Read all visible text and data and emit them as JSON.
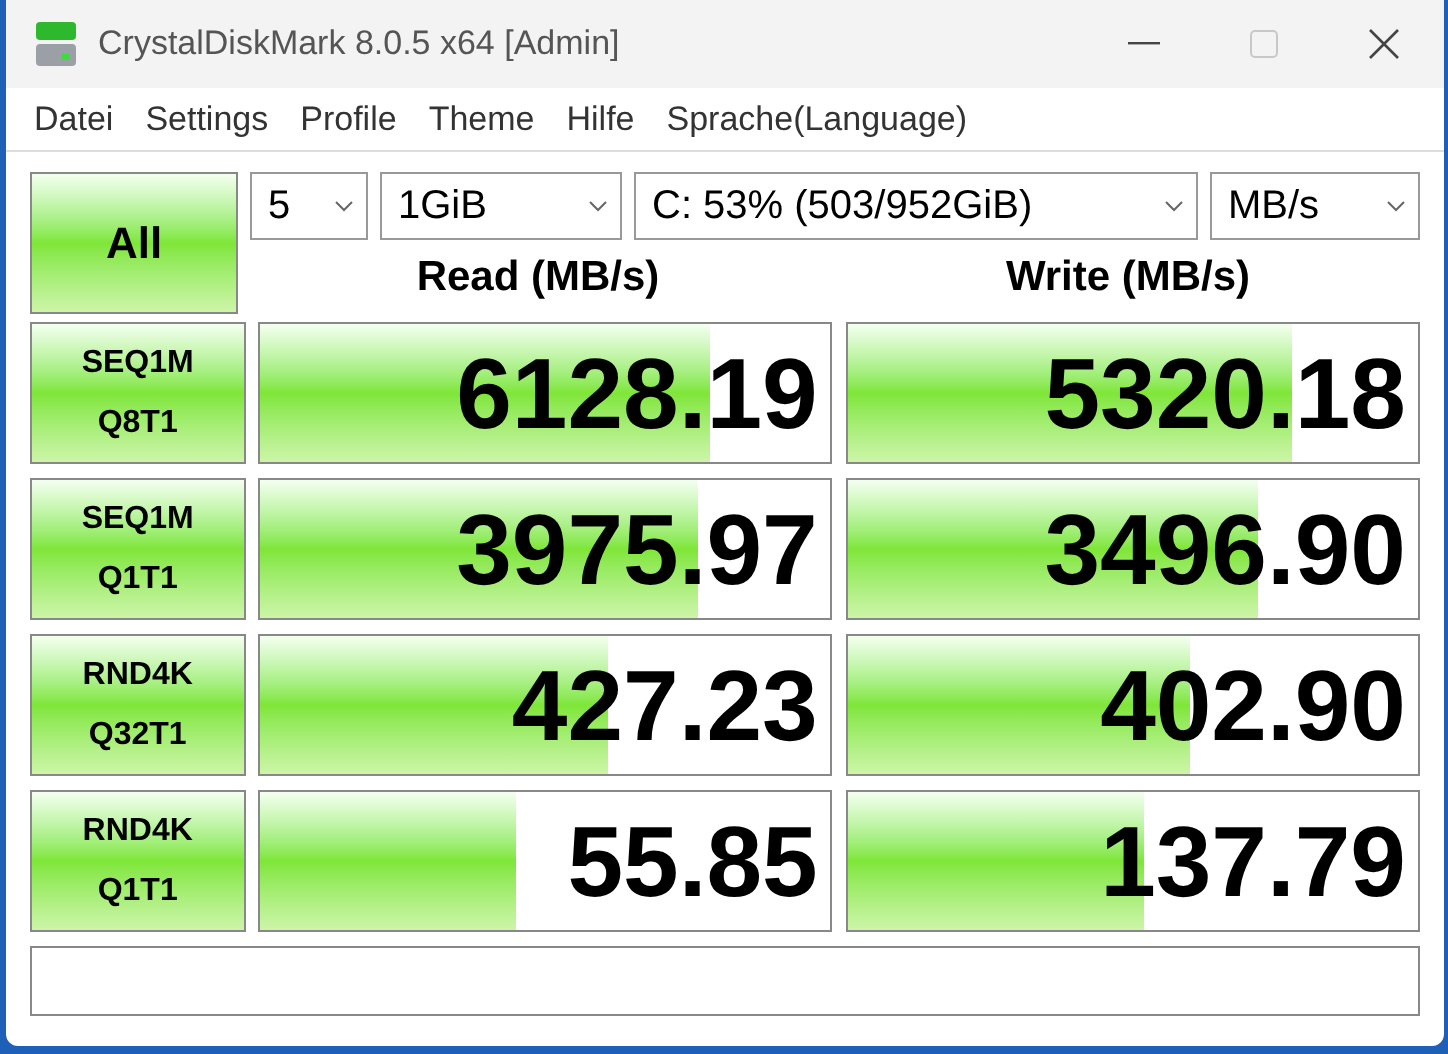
{
  "window": {
    "title": "CrystalDiskMark 8.0.5 x64 [Admin]",
    "maximize_disabled": true
  },
  "menu": [
    "Datei",
    "Settings",
    "Profile",
    "Theme",
    "Hilfe",
    "Sprache(Language)"
  ],
  "all_button": "All",
  "selectors": [
    {
      "kind": "count",
      "value": "5"
    },
    {
      "kind": "size",
      "value": "1GiB"
    },
    {
      "kind": "drive",
      "value": "C: 53% (503/952GiB)"
    },
    {
      "kind": "unit",
      "value": "MB/s"
    }
  ],
  "headers": {
    "read": "Read (MB/s)",
    "write": "Write (MB/s)"
  },
  "rows": [
    {
      "lines": [
        "SEQ1M",
        "Q8T1"
      ],
      "read": {
        "value": "6128.19",
        "level": 0.79
      },
      "write": {
        "value": "5320.18",
        "level": 0.78
      }
    },
    {
      "lines": [
        "SEQ1M",
        "Q1T1"
      ],
      "read": {
        "value": "3975.97",
        "level": 0.77
      },
      "write": {
        "value": "3496.90",
        "level": 0.72
      }
    },
    {
      "lines": [
        "RND4K",
        "Q32T1"
      ],
      "read": {
        "value": "427.23",
        "level": 0.61
      },
      "write": {
        "value": "402.90",
        "level": 0.6
      }
    },
    {
      "lines": [
        "RND4K",
        "Q1T1"
      ],
      "read": {
        "value": "55.85",
        "level": 0.45
      },
      "write": {
        "value": "137.79",
        "level": 0.52
      }
    }
  ]
}
